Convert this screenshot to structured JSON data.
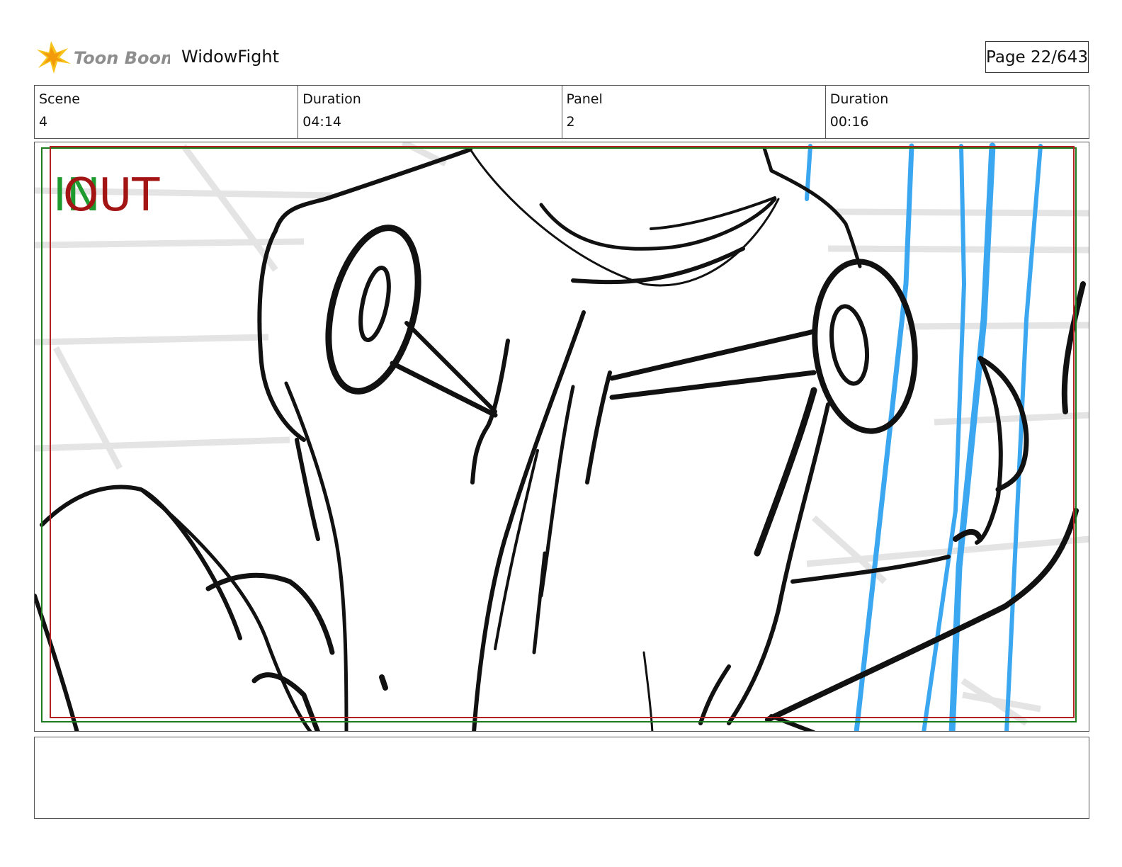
{
  "header": {
    "logo_text": "Toon Boom",
    "project_title": "WidowFight",
    "page_label": "Page",
    "page_value": "22/643"
  },
  "info": {
    "scene_label": "Scene",
    "scene_value": "4",
    "scene_duration_label": "Duration",
    "scene_duration_value": "04:14",
    "panel_label": "Panel",
    "panel_value": "2",
    "panel_duration_label": "Duration",
    "panel_duration_value": "00:16"
  },
  "panel": {
    "in_marker": "IN",
    "out_marker": "OUT",
    "colors": {
      "in": "#1f9a2e",
      "out": "#a31515",
      "safe_frame_red": "#b22222",
      "safe_frame_green": "#1e7d1e",
      "grid": "#e4e4e4",
      "speed_lines": "#3aa7f0",
      "ink": "#111111"
    }
  },
  "notes": {
    "text": ""
  }
}
